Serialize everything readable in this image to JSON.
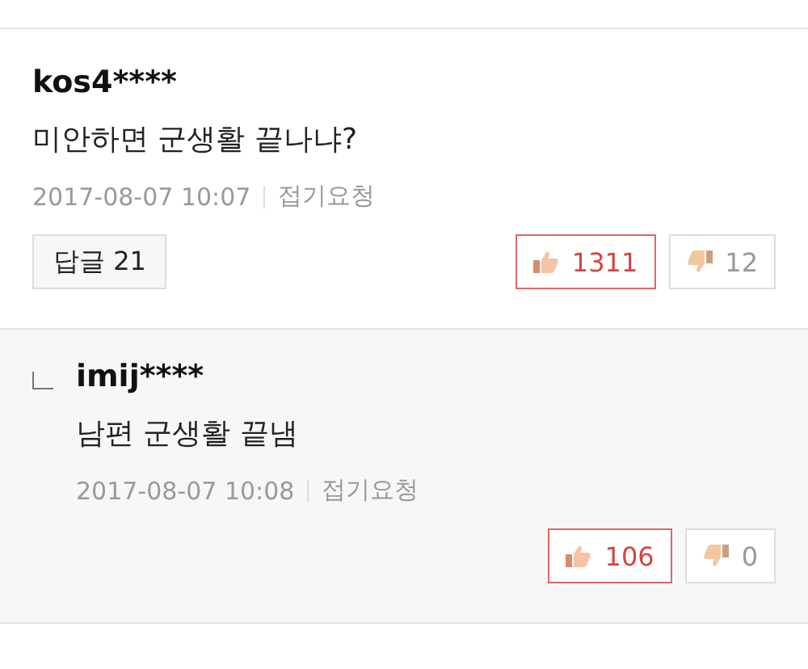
{
  "comments": [
    {
      "kind": "comment",
      "user": "kos4****",
      "text": "미안하면 군생활 끝나냐?",
      "date": "2017-08-07 10:07",
      "fold": "접기요청",
      "reply_button": "답글 21",
      "like": {
        "count": "1311",
        "highlighted": true
      },
      "dislike": {
        "count": "12",
        "highlighted": false
      }
    },
    {
      "kind": "reply",
      "user": "imij****",
      "text": "남편 군생활 끝냄",
      "date": "2017-08-07 10:08",
      "fold": "접기요청",
      "like": {
        "count": "106",
        "highlighted": true
      },
      "dislike": {
        "count": "0",
        "highlighted": false
      }
    }
  ]
}
